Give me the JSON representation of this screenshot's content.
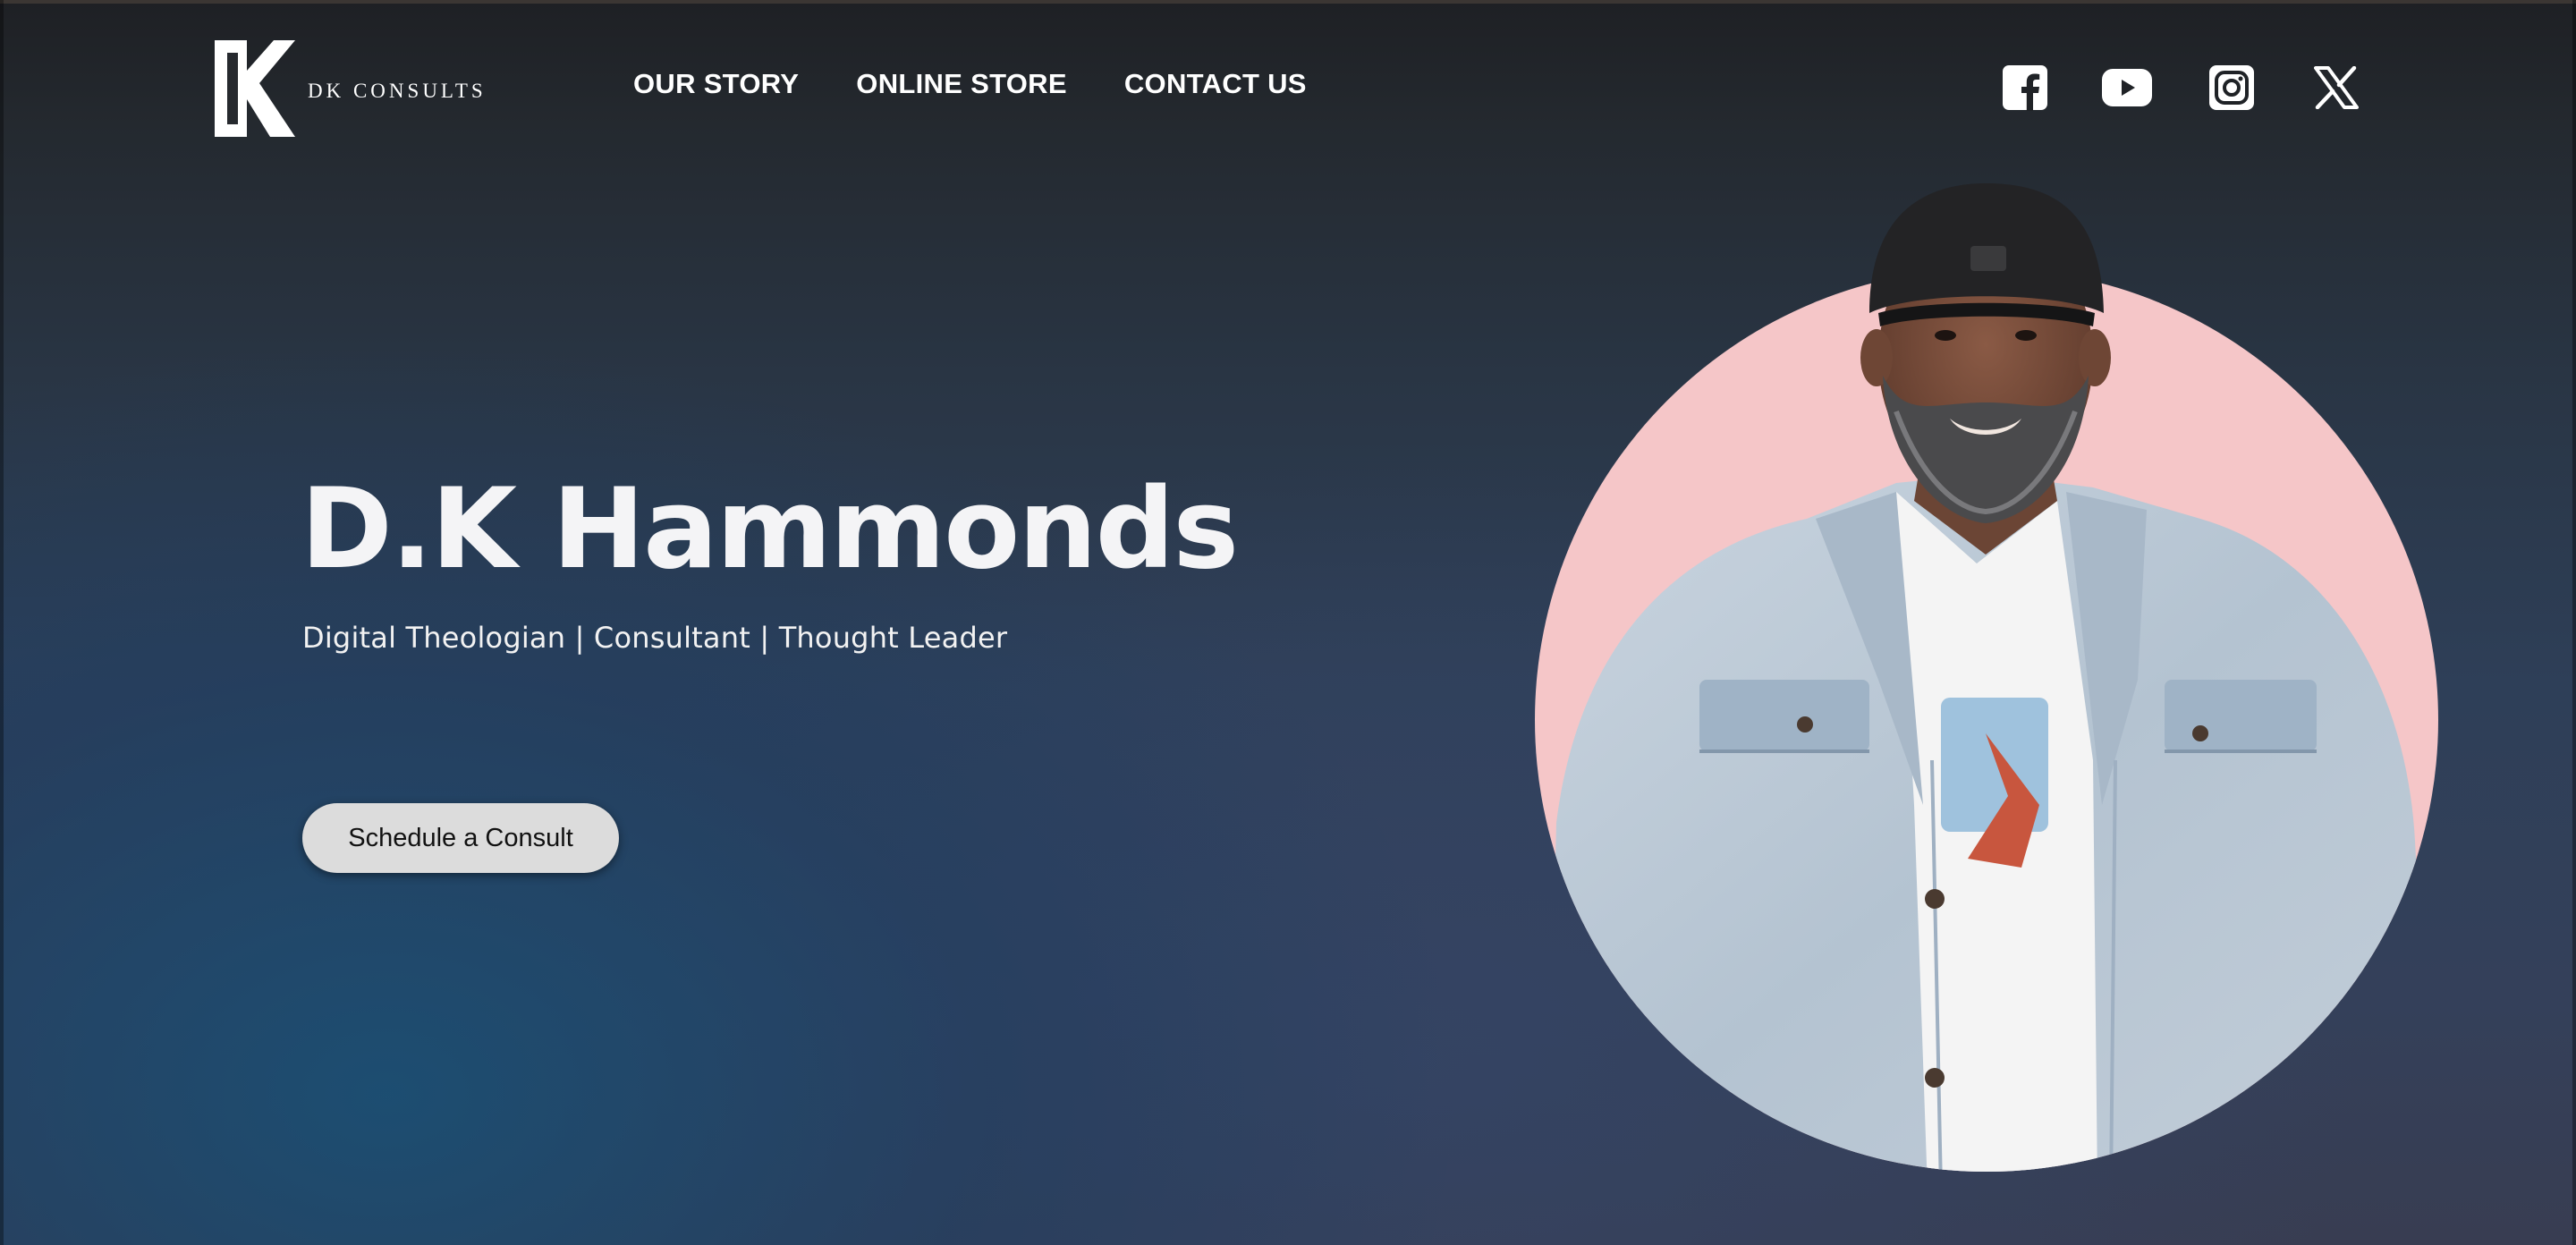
{
  "header": {
    "brand_name": "DK CONSULTS",
    "nav": [
      {
        "label": "OUR STORY"
      },
      {
        "label": "ONLINE STORE"
      },
      {
        "label": "CONTACT US"
      }
    ],
    "social": [
      {
        "icon": "facebook-icon"
      },
      {
        "icon": "youtube-icon"
      },
      {
        "icon": "instagram-icon"
      },
      {
        "icon": "x-icon"
      }
    ]
  },
  "hero": {
    "title": "D.K Hammonds",
    "subtitle": "Digital Theologian | Consultant | Thought Leader",
    "cta_label": "Schedule a Consult",
    "portrait_bg_color": "#f5c6c8"
  },
  "colors": {
    "bg_top": "#1e2024",
    "bg_bottom": "#34405a",
    "accent_blue": "#185076",
    "button_bg": "#dcdcdc",
    "text": "#ffffff"
  }
}
